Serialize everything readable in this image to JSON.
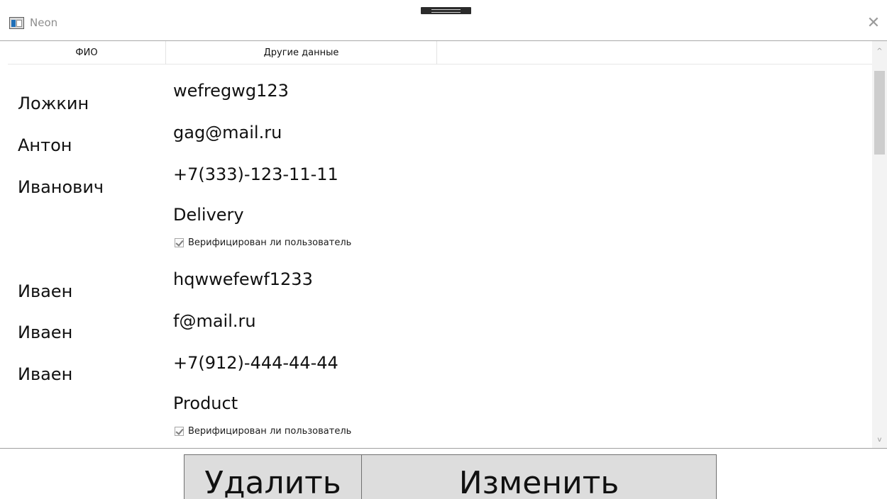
{
  "window": {
    "title": "Neon",
    "close_glyph": "✕",
    "icons": {
      "app": "app-window-icon",
      "close": "close-icon",
      "drag": "drag-handle"
    }
  },
  "table": {
    "columns": [
      "ФИО",
      "Другие данные"
    ],
    "records": [
      {
        "last_name": "Ложкин",
        "first_name": "Антон",
        "patronymic": "Иванович",
        "login": "wefregwg123",
        "email": "gag@mail.ru",
        "phone": "+7(333)-123-11-11",
        "role": "Delivery",
        "verified_label": "Верифицирован ли пользователь",
        "verified": true
      },
      {
        "last_name": "Иваен",
        "first_name": "Иваен",
        "patronymic": "Иваен",
        "login": "hqwwefewf1233",
        "email": "f@mail.ru",
        "phone": "+7(912)-444-44-44",
        "role": "Product",
        "verified_label": "Верифицирован ли пользователь",
        "verified": true
      }
    ]
  },
  "scrollbar": {
    "up_glyph": "^",
    "down_glyph": "v"
  },
  "buttons": {
    "delete": "Удалить",
    "edit": "Изменить"
  }
}
